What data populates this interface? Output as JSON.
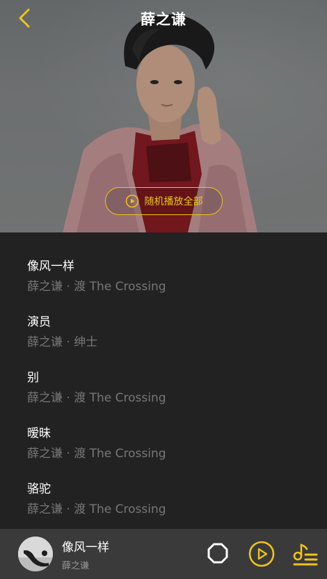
{
  "header": {
    "title": "薛之谦",
    "shuffle_label": "随机播放全部"
  },
  "songs": [
    {
      "name": "像风一样",
      "meta": "薛之谦 · 渡 The Crossing"
    },
    {
      "name": "演员",
      "meta": "薛之谦 · 绅士"
    },
    {
      "name": "别",
      "meta": "薛之谦 · 渡 The Crossing"
    },
    {
      "name": "暧昧",
      "meta": "薛之谦 · 渡 The Crossing"
    },
    {
      "name": "骆驼",
      "meta": "薛之谦 · 渡 The Crossing"
    }
  ],
  "player": {
    "title": "像风一样",
    "artist": "薛之谦"
  },
  "colors": {
    "accent": "#f0c419",
    "background": "#222222",
    "player_bar": "#3a3a3a"
  },
  "icons": {
    "back": "chevron-left-icon",
    "shuffle": "play-circle-icon",
    "mode": "octagon-icon",
    "play": "play-circle-icon",
    "playlist": "playlist-icon"
  }
}
